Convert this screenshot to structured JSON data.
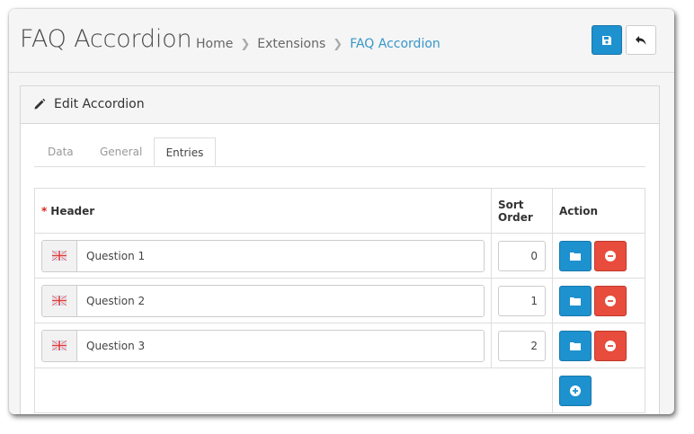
{
  "page": {
    "title": "FAQ Accordion",
    "breadcrumb": [
      "Home",
      "Extensions",
      "FAQ Accordion"
    ]
  },
  "panel": {
    "title": "Edit Accordion"
  },
  "tabs": [
    {
      "label": "Data",
      "active": false
    },
    {
      "label": "General",
      "active": false
    },
    {
      "label": "Entries",
      "active": true
    }
  ],
  "table": {
    "headers": {
      "required_mark": "*",
      "header": "Header",
      "sort_order": "Sort Order",
      "action": "Action"
    },
    "rows": [
      {
        "header": "Question 1",
        "sort_order": "0"
      },
      {
        "header": "Question 2",
        "sort_order": "1"
      },
      {
        "header": "Question 3",
        "sort_order": "2"
      }
    ]
  },
  "icons": {
    "save": "floppy-disk-icon",
    "back": "reply-arrow-icon",
    "pencil": "pencil-icon",
    "language": "uk-flag-icon",
    "image": "folder-icon",
    "remove": "minus-circle-icon",
    "add": "plus-circle-icon"
  },
  "colors": {
    "primary": "#1e91cf",
    "danger": "#e74c3c",
    "link": "#3797c8"
  }
}
